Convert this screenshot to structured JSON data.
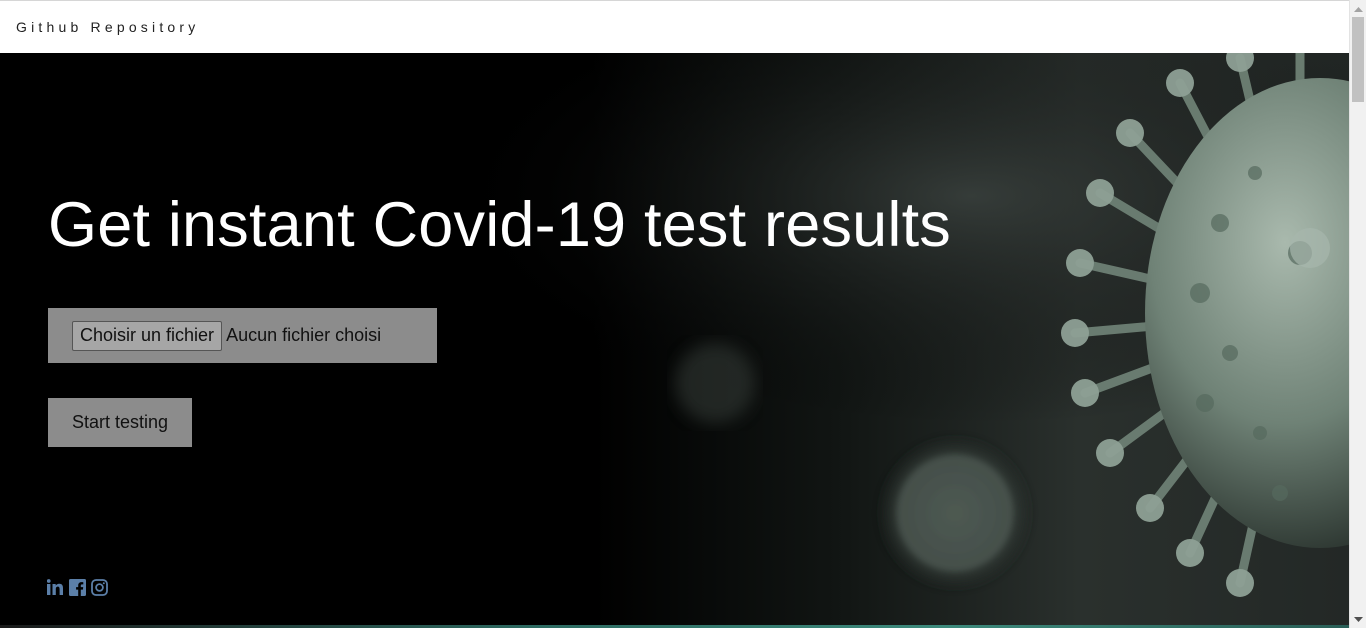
{
  "navbar": {
    "brand_label": "Github Repository"
  },
  "hero": {
    "headline": "Get instant Covid-19 test results",
    "file_input": {
      "button_label": "Choisir un fichier",
      "status_text": "Aucun fichier choisi"
    },
    "start_button_label": "Start testing"
  },
  "social": {
    "icons": [
      "linkedin-icon",
      "facebook-icon",
      "instagram-icon"
    ],
    "icon_color": "#5b7fa8"
  },
  "colors": {
    "navbar_bg": "#ffffff",
    "hero_bg": "#000000",
    "headline": "#ffffff",
    "button_bg": "#8c8c8c",
    "virus_tint": "#7f9486"
  }
}
